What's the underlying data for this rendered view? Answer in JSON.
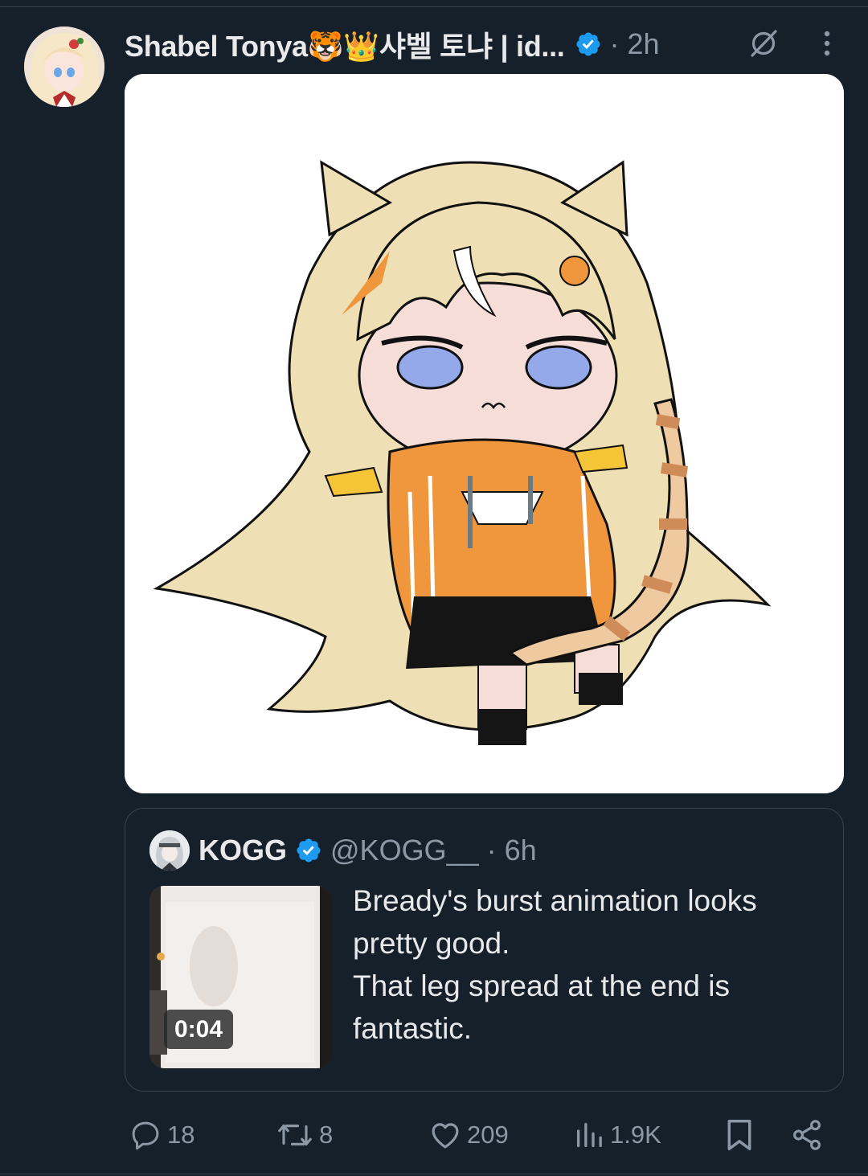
{
  "post": {
    "author_name": "Shabel Tonya🐯👑샤벨 토냐 | id...",
    "time": "· 2h",
    "icons": [
      "avatar",
      "verified-badge-icon",
      "grok-icon",
      "more-icon"
    ]
  },
  "quote": {
    "author_name": "KOGG",
    "author_handle": "@KOGG__ · 6h",
    "video_duration": "0:04",
    "text_lines": [
      "Bready's burst animation looks",
      "pretty good.",
      "That leg spread at the end is",
      "fantastic."
    ]
  },
  "actions": {
    "replies": "18",
    "reposts": "8",
    "likes": "209",
    "views": "1.9K"
  },
  "colors": {
    "background": "#15202b",
    "text": "#e7e9ea",
    "secondary": "#8b98a5",
    "border": "#38444d",
    "verified": "#1d9bf0"
  }
}
